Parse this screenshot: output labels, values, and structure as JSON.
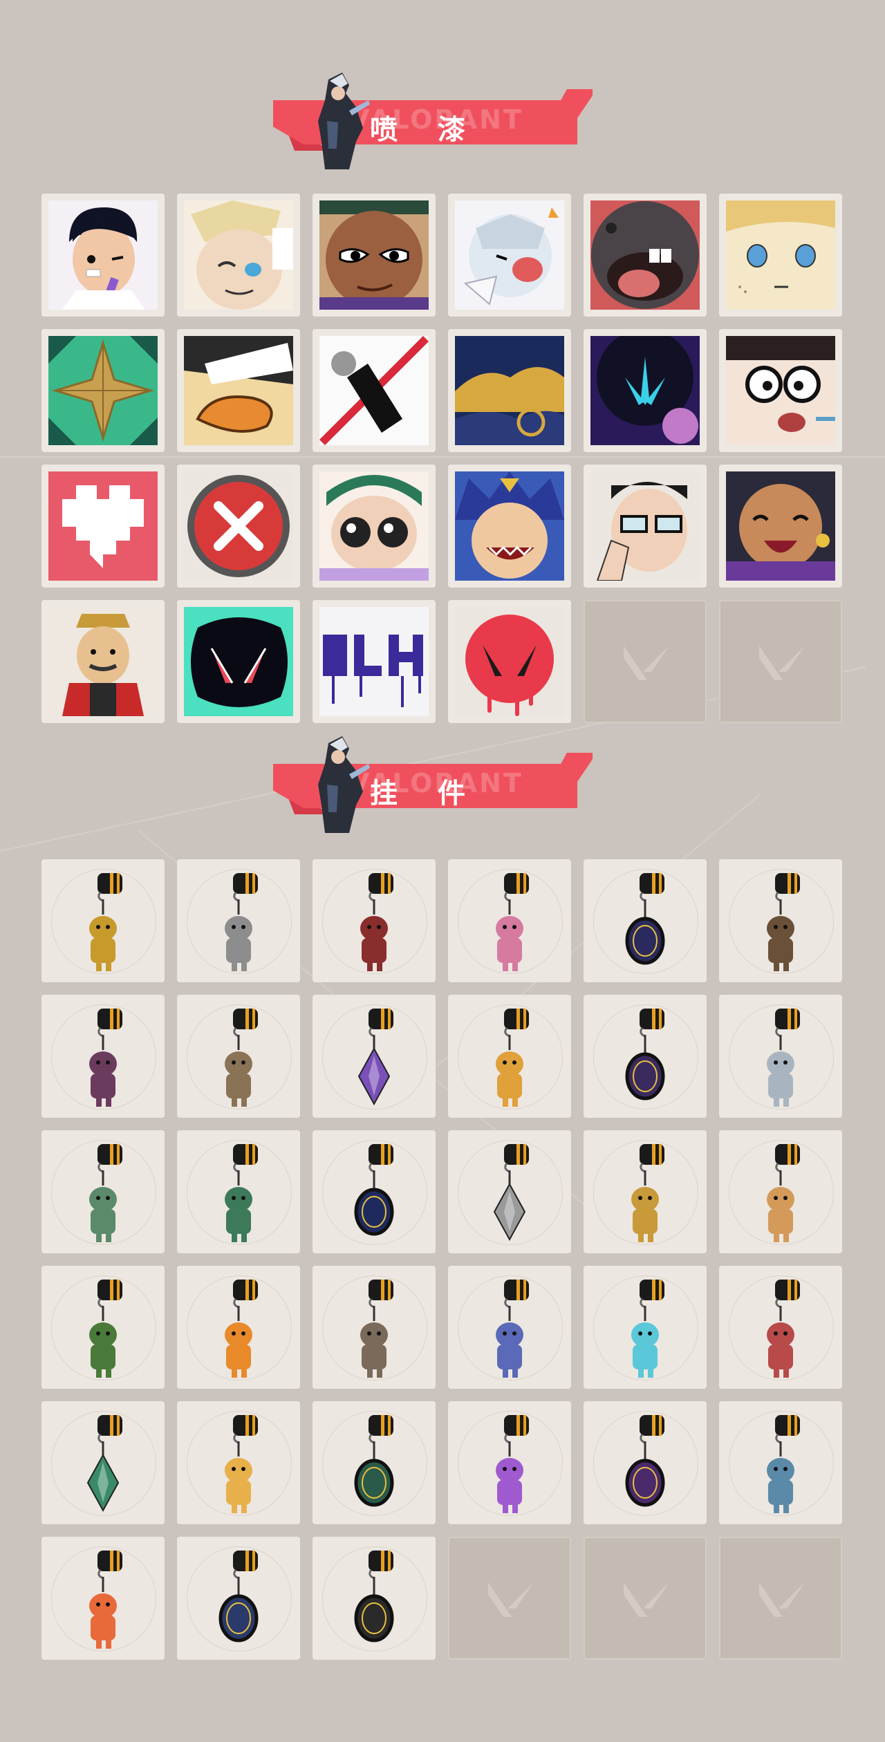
{
  "sections": {
    "sprays": {
      "title": "喷 漆",
      "watermark": "VALORANT"
    },
    "buddies": {
      "title": "挂 件",
      "watermark": "VALORANT"
    }
  },
  "colors": {
    "accent": "#f0505d",
    "background": "#cbc3bd",
    "tile": "#ede8e2",
    "empty_slot": "#c4bbb2"
  },
  "sprays": [
    {
      "name": "spray-boy-wink"
    },
    {
      "name": "spray-blonde-cat-boy"
    },
    {
      "name": "spray-smug-face"
    },
    {
      "name": "spray-chibi-crying"
    },
    {
      "name": "spray-dark-creature-tongue"
    },
    {
      "name": "spray-blonde-neutral-face"
    },
    {
      "name": "spray-gold-star-emblem"
    },
    {
      "name": "spray-duck-beak"
    },
    {
      "name": "spray-no-spray-can"
    },
    {
      "name": "spray-golden-clouds"
    },
    {
      "name": "spray-purple-leaf"
    },
    {
      "name": "spray-glasses-shocked"
    },
    {
      "name": "spray-pixel-heart"
    },
    {
      "name": "spray-red-x-button"
    },
    {
      "name": "spray-big-eyes-girl"
    },
    {
      "name": "spray-blue-hair-yell"
    },
    {
      "name": "spray-glasses-praying"
    },
    {
      "name": "spray-laughing-girl"
    },
    {
      "name": "spray-nutcracker"
    },
    {
      "name": "spray-valorant-splash-teal"
    },
    {
      "name": "spray-graffiti-tag"
    },
    {
      "name": "spray-red-valorant-drip"
    },
    {
      "name": "empty"
    },
    {
      "name": "empty"
    }
  ],
  "buddies": [
    {
      "name": "buddy-gold-creature",
      "color": "#c79a2c"
    },
    {
      "name": "buddy-gray-box",
      "color": "#8d8d8d"
    },
    {
      "name": "buddy-red-rope",
      "color": "#8a2d2d"
    },
    {
      "name": "buddy-cupcake",
      "color": "#d67aa0"
    },
    {
      "name": "buddy-ep9-medal",
      "color": "#2a2a5e"
    },
    {
      "name": "buddy-brown-gadget",
      "color": "#6b5038"
    },
    {
      "name": "buddy-agent-figure",
      "color": "#6b3b5e"
    },
    {
      "name": "buddy-cowboy-figure",
      "color": "#8a7355"
    },
    {
      "name": "buddy-purple-crystal",
      "color": "#7a4fb8"
    },
    {
      "name": "buddy-lava-lamp",
      "color": "#e0a03a"
    },
    {
      "name": "buddy-ep9-medal-2",
      "color": "#3a2a5e"
    },
    {
      "name": "buddy-white-hair-chibi",
      "color": "#a8b5c0"
    },
    {
      "name": "buddy-coffee-machine",
      "color": "#5a8a6a"
    },
    {
      "name": "buddy-spray-can",
      "color": "#3c7a5a"
    },
    {
      "name": "buddy-ep9-medal-3",
      "color": "#1e2a5e"
    },
    {
      "name": "buddy-silver-diamond",
      "color": "#9a9a9a"
    },
    {
      "name": "buddy-gold-robot",
      "color": "#c89a3a"
    },
    {
      "name": "buddy-corgi-dog",
      "color": "#d49a5a"
    },
    {
      "name": "buddy-green-mask",
      "color": "#4a7a3a"
    },
    {
      "name": "buddy-flame-trophy",
      "color": "#e88a2a"
    },
    {
      "name": "buddy-raccoon",
      "color": "#7a6a5a"
    },
    {
      "name": "buddy-mecha-robot",
      "color": "#5a6ab8"
    },
    {
      "name": "buddy-blue-blade",
      "color": "#5ac8d8"
    },
    {
      "name": "buddy-red-octopus",
      "color": "#b84a4a"
    },
    {
      "name": "buddy-green-gem",
      "color": "#3a8a6a"
    },
    {
      "name": "buddy-sun-cloud",
      "color": "#e8b04a"
    },
    {
      "name": "buddy-ep8-medal",
      "color": "#2a5a4a"
    },
    {
      "name": "buddy-lotus-flame",
      "color": "#a05ad0"
    },
    {
      "name": "buddy-ep8-medal-2",
      "color": "#4a2a6a"
    },
    {
      "name": "buddy-ufo",
      "color": "#5a8aa8"
    },
    {
      "name": "buddy-orange-lion",
      "color": "#e86a3a"
    },
    {
      "name": "buddy-ep7-medal",
      "color": "#2a3a6a"
    },
    {
      "name": "buddy-valorant-emblem",
      "color": "#2a2a2a"
    },
    {
      "name": "empty"
    },
    {
      "name": "empty"
    },
    {
      "name": "empty"
    }
  ]
}
